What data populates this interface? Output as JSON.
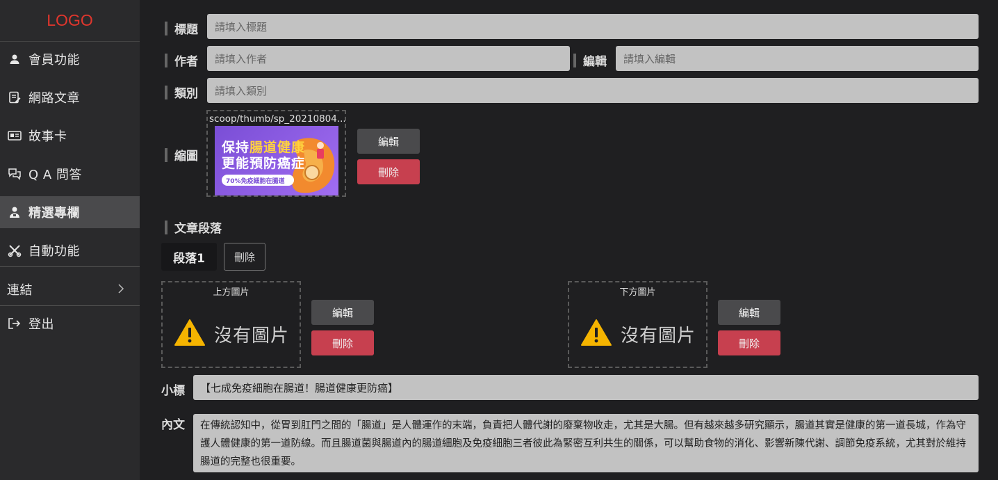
{
  "sidebar": {
    "logo": "LOGO",
    "items": [
      {
        "label": "會員功能",
        "icon": "user-icon"
      },
      {
        "label": "網路文章",
        "icon": "edit-note-icon"
      },
      {
        "label": "故事卡",
        "icon": "id-card-icon"
      },
      {
        "label": "Q A 問答",
        "icon": "chat-bubbles-icon"
      },
      {
        "label": "精選專欄",
        "icon": "person-badge-icon",
        "active": true
      },
      {
        "label": "自動功能",
        "icon": "tools-icon"
      },
      {
        "label": "連結",
        "icon": "chevron-right-icon"
      },
      {
        "label": "登出",
        "icon": "logout-icon"
      }
    ]
  },
  "form": {
    "title_label": "標題",
    "title_placeholder": "請填入標題",
    "author_label": "作者",
    "author_placeholder": "請填入作者",
    "editor_label": "編輯",
    "editor_placeholder": "請填入編輯",
    "category_label": "類別",
    "category_placeholder": "請填入類別",
    "thumb_label": "縮圖",
    "thumb_path": "scoop/thumb/sp_20210804....",
    "thumb_image_text": {
      "line1a": "保持",
      "line1b": "腸道健康",
      "line2": "更能預防癌症",
      "pill": "70%免疫細胞在腸道"
    },
    "thumb_edit": "編輯",
    "thumb_delete": "刪除"
  },
  "section": {
    "title": "文章段落",
    "tab_label": "段落1",
    "tab_delete": "刪除",
    "top_image_caption": "上方圖片",
    "bottom_image_caption": "下方圖片",
    "no_image": "沒有圖片",
    "edit": "編輯",
    "delete": "刪除",
    "subtitle_label": "小標",
    "subtitle_value": "【七成免疫細胞在腸道！腸道健康更防癌】",
    "content_label": "內文",
    "content_value": "在傳統認知中，從胃到肛門之間的「腸道」是人體運作的末端，負責把人體代謝的廢棄物收走，尤其是大腸。但有越來越多研究顯示，腸道其實是健康的第一道長城，作為守護人體健康的第一道防線。而且腸道菌與腸道內的腸道細胞及免疫細胞三者彼此為緊密互利共生的關係，可以幫助食物的消化、影響新陳代謝、調節免疫系統，尤其對於維持腸道的完整也很重要。"
  },
  "colors": {
    "accent_red": "#c7404f",
    "logo_red": "#e0362d",
    "warning_yellow": "#f5b400"
  }
}
